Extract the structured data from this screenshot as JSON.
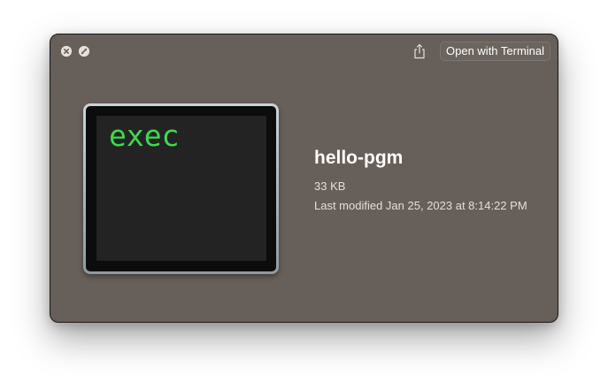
{
  "toolbar": {
    "close_icon": "close-icon",
    "fullscreen_icon": "fullscreen-icon",
    "share_icon": "share-icon",
    "open_button_label": "Open with Terminal"
  },
  "preview": {
    "icon_text": "exec",
    "icon_text_color": "#3fd94e",
    "file_name": "hello-pgm",
    "file_size": "33 KB",
    "last_modified": "Last modified Jan 25, 2023 at 8:14:22 PM"
  },
  "colors": {
    "window_background": "#675f59"
  }
}
